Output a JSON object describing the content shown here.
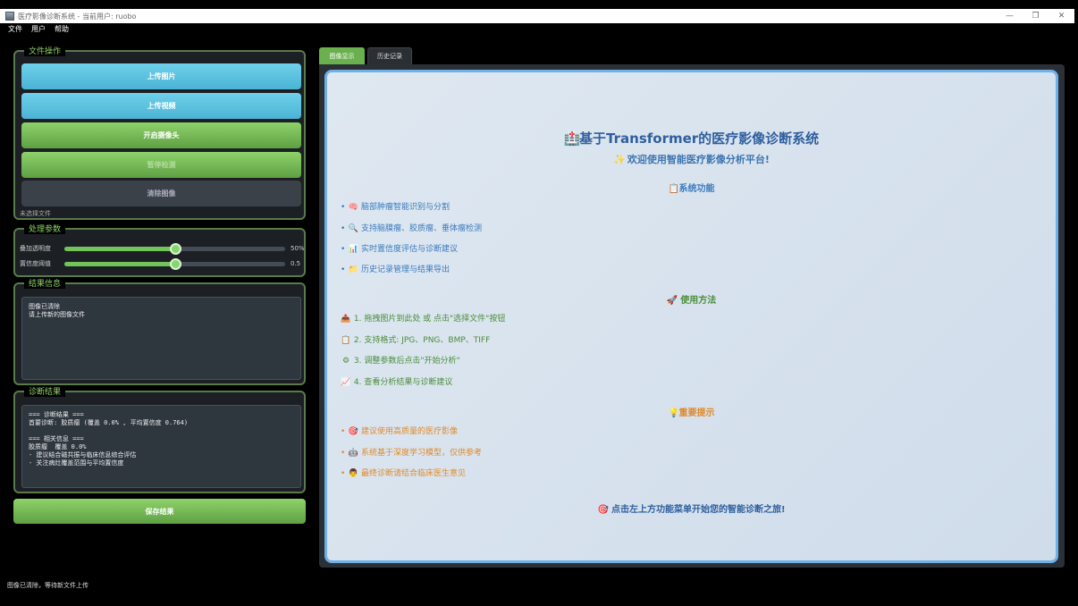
{
  "window": {
    "title": "医疗影像诊断系统 - 当前用户: ruobo",
    "controls": [
      "—",
      "❐",
      "✕"
    ]
  },
  "menu": [
    "文件",
    "用户",
    "帮助"
  ],
  "file_ops": {
    "title": "文件操作",
    "upload_image": "上传图片",
    "upload_video": "上传视频",
    "open_camera": "开启摄像头",
    "stop_detect": "暂停检测",
    "clear_image": "清除图像",
    "file_hint": "未选择文件"
  },
  "params": {
    "title": "处理参数",
    "overlay_label": "叠加透明度",
    "overlay_value": "50%",
    "overlay_fraction": 0.5,
    "conf_label": "置信度阈值",
    "conf_value": "0.5",
    "conf_fraction": 0.5
  },
  "result_info": {
    "title": "结果信息",
    "text": "图像已清除\n请上传新的图像文件"
  },
  "diagnosis": {
    "title": "诊断结果",
    "text": "=== 诊断结果 ===\n首要诊断: 胶质瘤 (覆盖 0.0% , 平均置信度 0.764)\n\n=== 相关信息 ===\n胶质瘤  覆盖 0.0%\n- 建议结合磁共振与临床信息综合评估\n- 关注病灶覆盖范围与平均置信度"
  },
  "save_button": "保存结果",
  "status": "图像已清除，等待新文件上传",
  "tabs": [
    "图像显示",
    "历史记录"
  ],
  "welcome": {
    "title": "基于Transformer的医疗影像诊断系统",
    "subtitle": "欢迎使用智能医疗影像分析平台!",
    "features_title": "系统功能",
    "features": [
      {
        "icon": "🧠",
        "text": "脑部肿瘤智能识别与分割"
      },
      {
        "icon": "🔍",
        "text": "支持脑膜瘤、胶质瘤、垂体瘤检测"
      },
      {
        "icon": "📊",
        "text": "实时置信度评估与诊断建议"
      },
      {
        "icon": "📁",
        "text": "历史记录管理与结果导出"
      }
    ],
    "usage_title": "使用方法",
    "usage": [
      {
        "icon": "📤",
        "text": "1.  拖拽图片到此处 或 点击\"选择文件\"按钮"
      },
      {
        "icon": "📋",
        "text": "2.  支持格式: JPG、PNG、BMP、TIFF"
      },
      {
        "icon": "⚙",
        "text": "3.  调整参数后点击\"开始分析\""
      },
      {
        "icon": "📈",
        "text": "4.  查看分析结果与诊断建议"
      }
    ],
    "tips_title": "重要提示",
    "tips": [
      {
        "icon": "🎯",
        "text": "建议使用高质量的医疗影像"
      },
      {
        "icon": "🤖",
        "text": "系统基于深度学习模型，仅供参考"
      },
      {
        "icon": "👨",
        "text": "最终诊断请结合临床医生意见"
      }
    ],
    "footer": "点击左上方功能菜单开始您的智能诊断之旅!"
  }
}
